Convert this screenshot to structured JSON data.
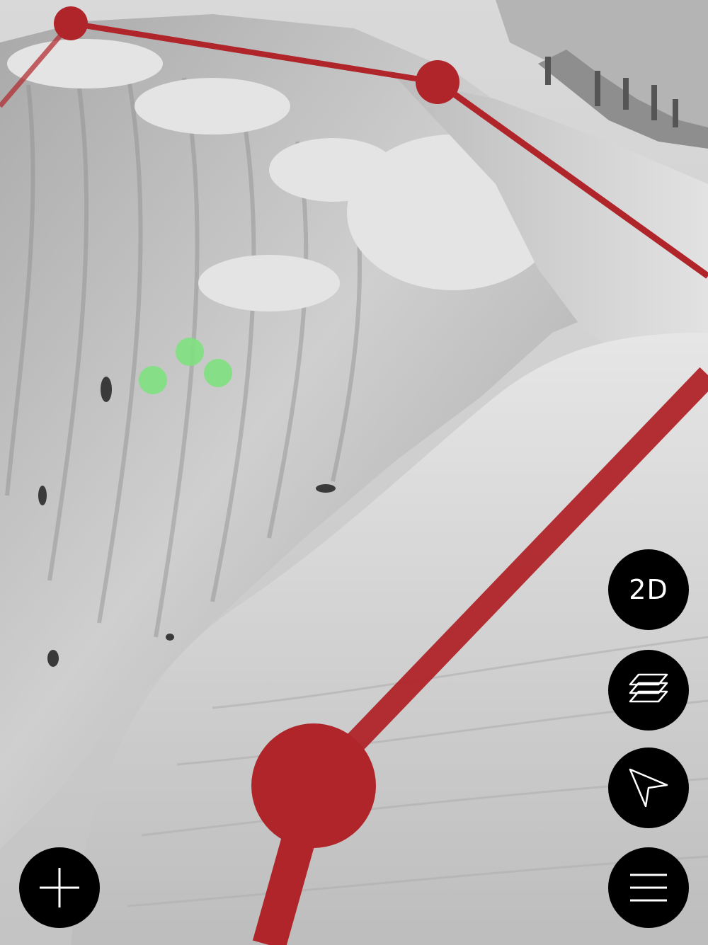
{
  "map": {
    "view": "3D terrain",
    "route_color": "#b0252a",
    "waypoint_colors": {
      "route": "#b0252a",
      "poi": "#7ee07e"
    }
  },
  "controls": {
    "view_toggle_label": "2D",
    "layers_icon": "layers-icon",
    "locate_icon": "navigation-arrow-icon",
    "menu_icon": "hamburger-menu-icon",
    "add_icon": "plus-icon"
  }
}
